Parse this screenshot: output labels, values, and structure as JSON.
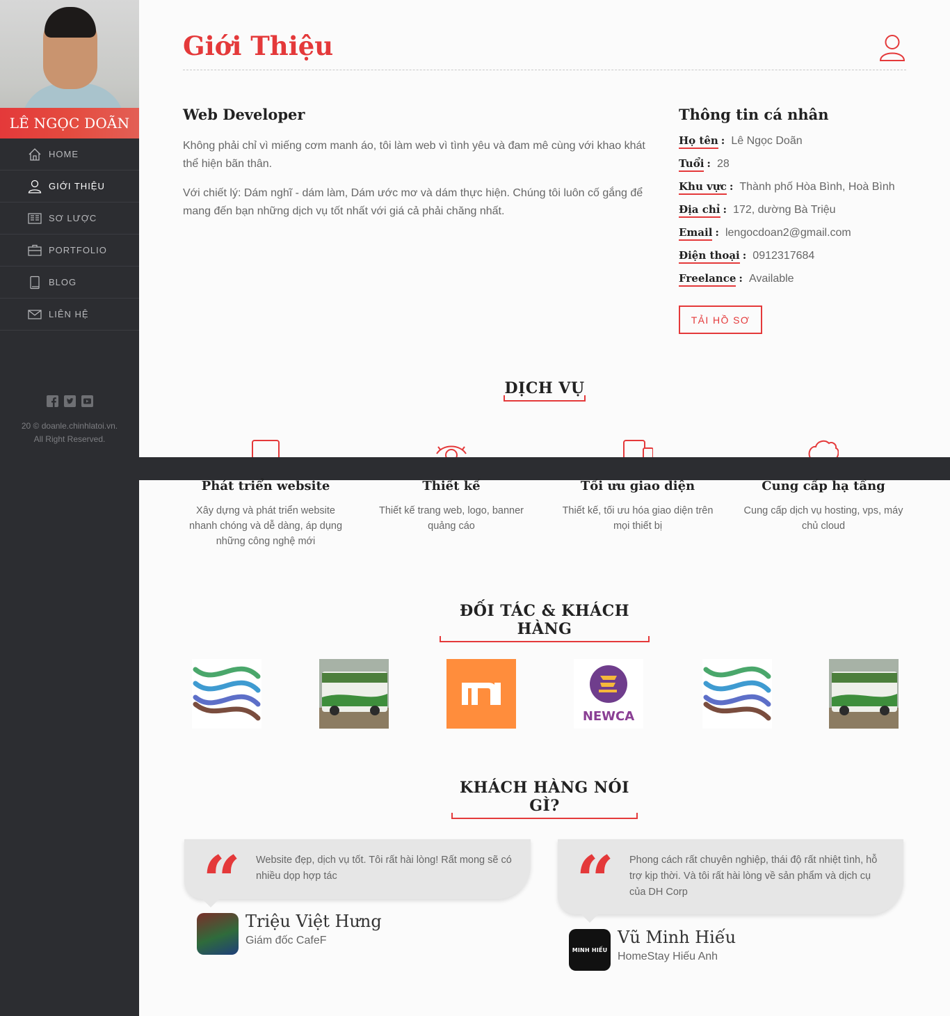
{
  "sidebar": {
    "name": "LÊ NGỌC DOÃN",
    "nav": [
      {
        "label": "HOME",
        "icon": "home-icon"
      },
      {
        "label": "GIỚI THIỆU",
        "icon": "user-icon"
      },
      {
        "label": "SƠ LƯỢC",
        "icon": "resume-icon"
      },
      {
        "label": "PORTFOLIO",
        "icon": "briefcase-icon"
      },
      {
        "label": "BLOG",
        "icon": "book-icon"
      },
      {
        "label": "LIÊN HỆ",
        "icon": "envelope-icon"
      }
    ],
    "active_item": "GIỚI THIỆU",
    "social": [
      "facebook-icon",
      "twitter-icon",
      "youtube-icon"
    ],
    "copyright_line1": "20 © doanle.chinhlatoi.vn.",
    "copyright_line2": "All Right Reserved."
  },
  "page": {
    "title": "Giới Thiệu",
    "accent_color": "#e4393a"
  },
  "about": {
    "heading": "Web Developer",
    "paragraph1": "Không phải chỉ vì miếng cơm manh áo, tôi làm web vì tình yêu và đam mê cùng với khao khát thể hiện bãn thân.",
    "paragraph2": "Với chiết lý: Dám nghĩ - dám làm, Dám ước mơ và dám thực hiện. Chúng tôi luôn cố gắng để mang đến bạn những dịch vụ tốt nhất với giá cả phải chăng nhất."
  },
  "info": {
    "heading": "Thông tin cá nhân",
    "rows": [
      {
        "label": "Họ tên",
        "value": "Lê Ngọc Doãn"
      },
      {
        "label": "Tuổi",
        "value": "28"
      },
      {
        "label": "Khu vực",
        "value": "Thành phố Hòa Bình, Hoà Bình"
      },
      {
        "label": "Địa chỉ",
        "value": "172, dường Bà Triệu"
      },
      {
        "label": "Email",
        "value": "lengocdoan2@gmail.com"
      },
      {
        "label": "Điện thoại",
        "value": "0912317684"
      },
      {
        "label": "Freelance",
        "value": "Available"
      }
    ],
    "download_label": "TẢI HỒ SƠ"
  },
  "services": {
    "title": "DỊCH VỤ",
    "items": [
      {
        "title": "Phát triển website",
        "desc": "Xây dựng và phát triển website nhanh chóng và dễ dàng, áp dụng những công nghệ mới",
        "icon": "monitor-icon"
      },
      {
        "title": "Thiết kế",
        "desc": "Thiết kế trang web, logo, banner quảng cáo",
        "icon": "eye-icon"
      },
      {
        "title": "Tối ưu giao diện",
        "desc": "Thiết kế, tối ưu hóa giao diện trên mọi thiết bị",
        "icon": "devices-icon"
      },
      {
        "title": "Cung cấp hạ tầng",
        "desc": "Cung cấp dịch vụ hosting, vps, máy chủ cloud",
        "icon": "cloud-icon"
      }
    ]
  },
  "partners": {
    "title": "ĐỐI TÁC & KHÁCH HÀNG",
    "logos": [
      "wave-logo",
      "bus-logo",
      "mi-logo",
      "newca-logo",
      "wave-logo",
      "bus-logo"
    ],
    "mi_text": "mi",
    "newca_text": "NEWCA"
  },
  "testimonials": {
    "title": "KHÁCH HÀNG NÓI GÌ?",
    "items": [
      {
        "text": "Website đẹp, dịch vụ tốt. Tôi rất hài lòng! Rất mong sẽ có nhiều dọp hợp tác",
        "name": "Triệu Việt Hưng",
        "role": "Giám đốc CafeF"
      },
      {
        "text": "Phong cách rất chuyên nghiệp, thái độ rất nhiệt tình, hỗ trợ kịp thời. Và tôi rất hài lòng về sản phẩm và dịch cụ của DH Corp",
        "name": "Vũ Minh Hiếu",
        "role": "HomeStay Hiếu Anh",
        "avatar_text": "MINH HIẾU"
      }
    ]
  }
}
